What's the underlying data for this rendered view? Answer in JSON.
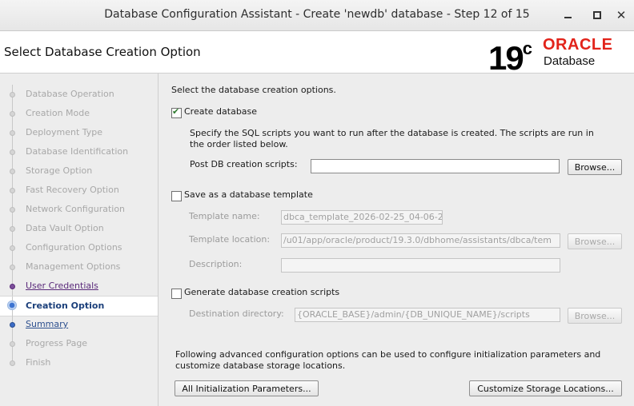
{
  "window": {
    "title": "Database Configuration Assistant - Create 'newdb' database - Step 12 of 15",
    "minimize_label": "",
    "close_glyph": "✕"
  },
  "header": {
    "page_title": "Select Database Creation Option",
    "logo_version": "19",
    "logo_version_sup": "c",
    "logo_brand": "ORACLE",
    "logo_product": "Database",
    "brand_color": "#e2231a"
  },
  "sidebar": {
    "steps": [
      {
        "label": "Database Operation",
        "state": "done"
      },
      {
        "label": "Creation Mode",
        "state": "done"
      },
      {
        "label": "Deployment Type",
        "state": "done"
      },
      {
        "label": "Database Identification",
        "state": "done"
      },
      {
        "label": "Storage Option",
        "state": "done"
      },
      {
        "label": "Fast Recovery Option",
        "state": "done"
      },
      {
        "label": "Network Configuration",
        "state": "done"
      },
      {
        "label": "Data Vault Option",
        "state": "done"
      },
      {
        "label": "Configuration Options",
        "state": "done"
      },
      {
        "label": "Management Options",
        "state": "done"
      },
      {
        "label": "User Credentials",
        "state": "link"
      },
      {
        "label": "Creation Option",
        "state": "current"
      },
      {
        "label": "Summary",
        "state": "link"
      },
      {
        "label": "Progress Page",
        "state": "pending"
      },
      {
        "label": "Finish",
        "state": "pending"
      }
    ]
  },
  "main": {
    "intro": "Select the database creation options.",
    "create_db": {
      "label": "Create database",
      "checked": true,
      "desc_line1": "Specify the SQL scripts you want to run after the database is created. The scripts are run in",
      "desc_line2": "the order listed below.",
      "post_scripts_label": "Post DB creation scripts:",
      "post_scripts_value": "",
      "browse_label": "Browse..."
    },
    "template": {
      "label": "Save as a database template",
      "checked": false,
      "name_label": "Template name:",
      "name_value": "dbca_template_2026-02-25_04-06-2",
      "location_label": "Template location:",
      "location_value": "/u01/app/oracle/product/19.3.0/dbhome/assistants/dbca/tem",
      "browse_label": "Browse...",
      "description_label": "Description:",
      "description_value": ""
    },
    "scripts": {
      "label": "Generate database creation scripts",
      "checked": false,
      "dest_label": "Destination directory:",
      "dest_value": "{ORACLE_BASE}/admin/{DB_UNIQUE_NAME}/scripts",
      "browse_label": "Browse..."
    },
    "advanced_line1": "Following advanced configuration options can be used to configure initialization parameters and",
    "advanced_line2": "customize database storage locations.",
    "init_params_button": "All Initialization Parameters...",
    "storage_button": "Customize Storage Locations..."
  }
}
